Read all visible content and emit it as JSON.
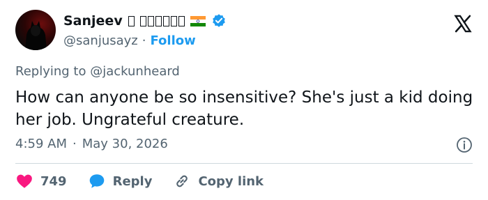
{
  "tweet": {
    "author_name": "Sanjeev",
    "handle": "@sanjusayz",
    "separator": "·",
    "follow_label": "Follow",
    "replying_prefix": "Replying to",
    "replying_to": "@jackunheard",
    "text": "How can anyone be so insensitive? She's just a kid doing her job. Ungrateful creature.",
    "time": "4:59 AM",
    "date": "May 30, 2026"
  },
  "actions": {
    "like_count": "749",
    "reply_label": "Reply",
    "copy_link_label": "Copy link"
  },
  "colors": {
    "accent": "#1d9bf0",
    "like": "#f91880",
    "muted": "#536471",
    "text": "#0f1419"
  },
  "icons": [
    "verified-badge-icon",
    "india-flag-icon",
    "x-logo-icon",
    "info-icon",
    "heart-icon",
    "reply-bubble-icon",
    "link-icon"
  ]
}
